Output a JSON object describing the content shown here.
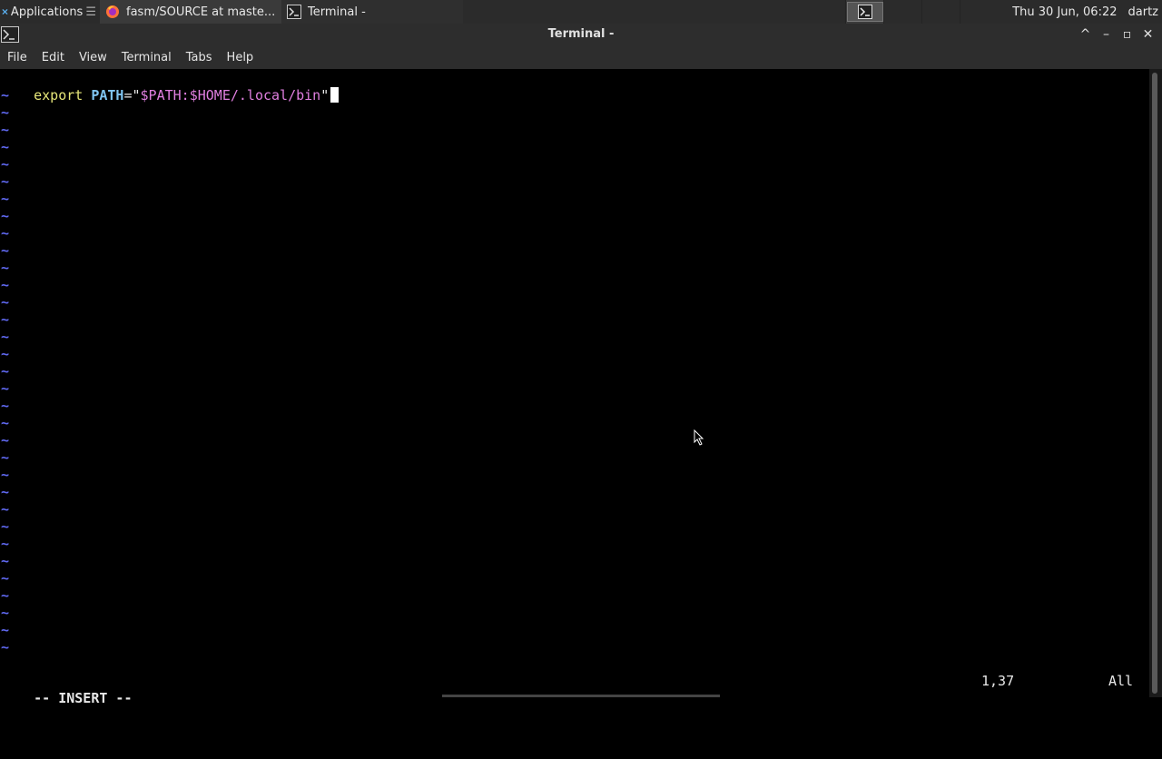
{
  "panel": {
    "applications_label": "Applications",
    "applications_menu_glyph": "☰",
    "tasks": [
      {
        "label": "fasm/SOURCE at maste...",
        "icon": "firefox-icon"
      },
      {
        "label": "Terminal -",
        "icon": "terminal-icon"
      }
    ],
    "clock": "Thu 30 Jun, 06:22",
    "user": "dartz"
  },
  "window": {
    "title": "Terminal -",
    "buttons": {
      "maximize_up": "^",
      "minimize": "–",
      "restore": "▫",
      "close": "✕"
    }
  },
  "menubar": {
    "items": [
      "File",
      "Edit",
      "View",
      "Terminal",
      "Tabs",
      "Help"
    ]
  },
  "editor": {
    "line1": {
      "keyword": "export",
      "variable": "PATH",
      "equals": "=",
      "quote_open": "\"",
      "value": "$PATH:$HOME/.local/bin",
      "quote_close": "\""
    },
    "tilde": "~",
    "mode": "-- INSERT --",
    "position": "1,37",
    "scroll": "All"
  },
  "colors": {
    "keyword": "#e7e779",
    "variable": "#7fc4f0",
    "string": "#e07fe0",
    "tilde": "#5f68f0"
  }
}
